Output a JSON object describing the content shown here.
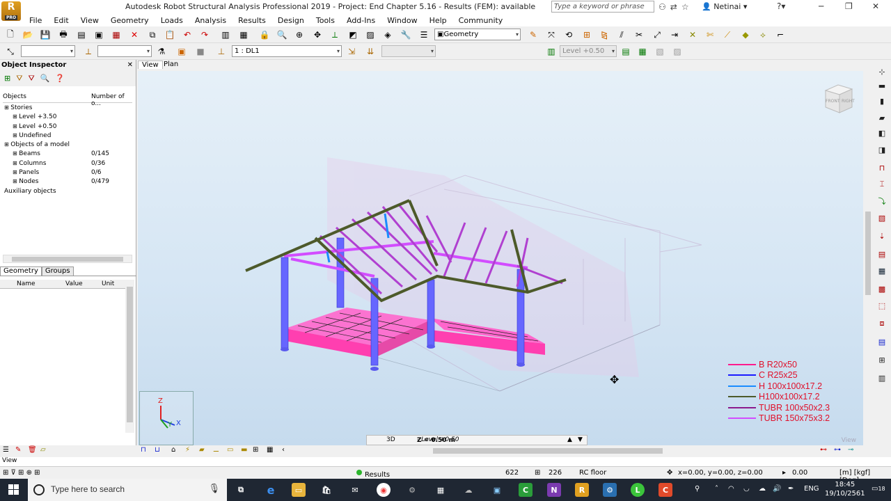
{
  "app": {
    "title": "Autodesk Robot Structural Analysis Professional 2019 - Project: End Chapter 5.16 - Results (FEM): available",
    "logo_letter": "R",
    "logo_badge": "PRO",
    "search_placeholder": "Type a keyword or phrase",
    "user": "Netinai"
  },
  "menu": [
    "File",
    "Edit",
    "View",
    "Geometry",
    "Loads",
    "Analysis",
    "Results",
    "Design",
    "Tools",
    "Add-Ins",
    "Window",
    "Help",
    "Community"
  ],
  "toolbar": {
    "layout_combo": "Geometry",
    "load_case_combo": "1 : DL1",
    "level_combo": "Level +0.50"
  },
  "inspector": {
    "title": "Object Inspector",
    "col_objects": "Objects",
    "col_number": "Number of o...",
    "tree": [
      {
        "label": "Stories",
        "value": "",
        "indent": 0
      },
      {
        "label": "Level +3.50",
        "value": "",
        "indent": 1
      },
      {
        "label": "Level +0.50",
        "value": "",
        "indent": 1
      },
      {
        "label": "Undefined",
        "value": "",
        "indent": 1
      },
      {
        "label": "Objects of a model",
        "value": "",
        "indent": 0
      },
      {
        "label": "Beams",
        "value": "0/145",
        "indent": 1
      },
      {
        "label": "Columns",
        "value": "0/36",
        "indent": 1
      },
      {
        "label": "Panels",
        "value": "0/6",
        "indent": 1
      },
      {
        "label": "Nodes",
        "value": "0/479",
        "indent": 1
      },
      {
        "label": "Auxiliary objects",
        "value": "",
        "indent": 0
      }
    ],
    "tab_geometry": "Geometry",
    "tab_groups": "Groups",
    "prop_name": "Name",
    "prop_value": "Value",
    "prop_unit": "Unit"
  },
  "view_tabs": {
    "view": "View",
    "plan": "Plan"
  },
  "legend": [
    {
      "label": "B R20x50",
      "color": "#ff1a8c"
    },
    {
      "label": "C R25x25",
      "color": "#1a1aff"
    },
    {
      "label": "H 100x100x17.2",
      "color": "#1a8cff"
    },
    {
      "label": "H100x100x17.2",
      "color": "#4d5a2a"
    },
    {
      "label": "TUBR 100x50x2.3",
      "color": "#8c1a8c"
    },
    {
      "label": "TUBR 150x75x3.2",
      "color": "#d24dff"
    }
  ],
  "coord_bar": {
    "mode": "3D",
    "z_value": "Z = 0.50 m",
    "level": " - Level +0.50"
  },
  "viewcube": {
    "front": "FRONT",
    "right": "RIGHT"
  },
  "axes": {
    "z": "Z",
    "y": "Y",
    "x": "X"
  },
  "view_label": "View",
  "bottom_view_row": "View",
  "status": {
    "results": "Results (FEM): available",
    "n1": "622",
    "n2": "226",
    "floor": "RC floor",
    "coords": "x=0.00, y=0.00, z=0.00",
    "value": "0.00",
    "units": "[m] [kgf] [Deg]"
  },
  "taskbar": {
    "search": "Type here to search",
    "lang": "ENG",
    "time": "18:45",
    "date": "19/10/2561",
    "notif_count": "18"
  }
}
